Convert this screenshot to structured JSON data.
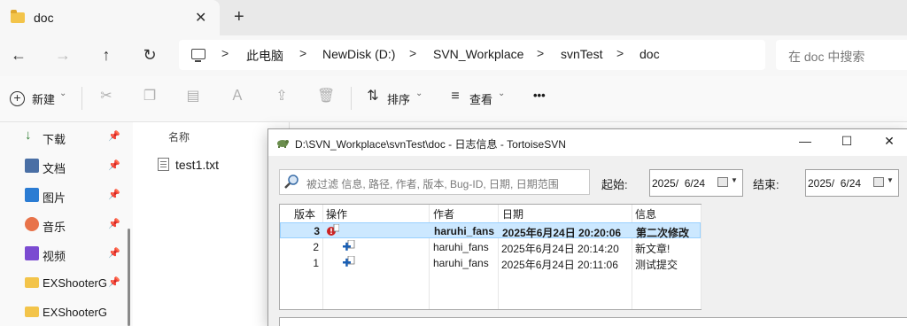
{
  "explorer": {
    "tab": {
      "title": "doc",
      "close": "✕",
      "new_tab": "+"
    },
    "nav": {
      "back": "←",
      "forward": "→",
      "up": "↑",
      "refresh": "↻"
    },
    "breadcrumb": {
      "separator": ">",
      "items": [
        "此电脑",
        "NewDisk (D:)",
        "SVN_Workplace",
        "svnTest",
        "doc"
      ]
    },
    "search": {
      "placeholder": "在 doc 中搜索"
    },
    "commands": {
      "new": "新建",
      "new_chevron": "⌄",
      "sort": "排序",
      "sort_chevron": "⌄",
      "view": "查看",
      "view_chevron": "⌄",
      "more": "•••"
    },
    "sidebar": {
      "items": [
        {
          "label": "下载",
          "icon": "download-icon",
          "color": "#2e7d32"
        },
        {
          "label": "文档",
          "icon": "document-icon",
          "color": "#4a6fa5"
        },
        {
          "label": "图片",
          "icon": "picture-icon",
          "color": "#2b7cd3"
        },
        {
          "label": "音乐",
          "icon": "music-icon",
          "color": "#e8734a"
        },
        {
          "label": "视频",
          "icon": "video-icon",
          "color": "#7b4bd1"
        },
        {
          "label": "EXShooterGame",
          "icon": "folder-icon",
          "color": "#f3c44a"
        },
        {
          "label": "EXShooterGame",
          "icon": "folder-icon",
          "color": "#f3c44a"
        }
      ],
      "pin_glyph": "📌"
    },
    "files": {
      "column_name": "名称",
      "items": [
        {
          "name": "test1.txt"
        }
      ]
    }
  },
  "dialog": {
    "title": "D:\\SVN_Workplace\\svnTest\\doc - 日志信息 - TortoiseSVN",
    "filter_placeholder": "被过滤 信息, 路径, 作者, 版本, Bug-ID, 日期, 日期范围",
    "from_label": "起始:",
    "from_date": "2025/  6/24",
    "to_label": "结束:",
    "to_date": "2025/  6/24",
    "columns": [
      "版本",
      "操作",
      "作者",
      "日期",
      "信息"
    ],
    "rows": [
      {
        "revision": "3",
        "action": "conflict-modified",
        "author": "haruhi_fans",
        "date": "2025年6月24日 20:20:06",
        "message": "第二次修改",
        "selected": true
      },
      {
        "revision": "2",
        "action": "added",
        "author": "haruhi_fans",
        "date": "2025年6月24日 20:14:20",
        "message": "新文章!",
        "selected": false
      },
      {
        "revision": "1",
        "action": "added",
        "author": "haruhi_fans",
        "date": "2025年6月24日 20:11:06",
        "message": "测试提交",
        "selected": false
      }
    ],
    "window_buttons": {
      "minimize": "—",
      "maximize": "☐",
      "close": "✕"
    }
  }
}
